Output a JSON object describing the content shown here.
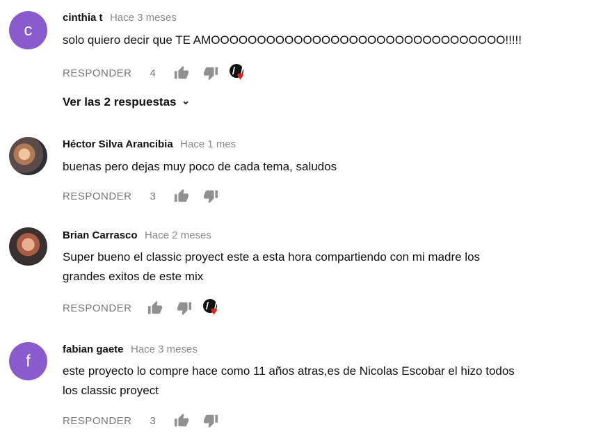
{
  "comments": [
    {
      "avatar_letter": "c",
      "author": "cinthia t",
      "time": "Hace 3 meses",
      "text_lines": [
        "solo quiero decir que TE AMOOOOOOOOOOOOOOOOOOOOOOOOOOOOOOOO!!!!!"
      ],
      "reply_label": "RESPONDER",
      "likes": "4",
      "creator_heart": true,
      "replies_label": "Ver las 2 respuestas"
    },
    {
      "avatar_letter": "",
      "author": "Héctor Silva Arancibia",
      "time": "Hace 1 mes",
      "text_lines": [
        "buenas pero dejas muy poco de cada tema, saludos"
      ],
      "reply_label": "RESPONDER",
      "likes": "3",
      "creator_heart": false
    },
    {
      "avatar_letter": "",
      "author": "Brian Carrasco",
      "time": "Hace 2 meses",
      "text_lines": [
        "Super bueno el classic proyect este a esta hora compartiendo con mi madre los",
        "grandes exitos de este mix"
      ],
      "reply_label": "RESPONDER",
      "likes": "",
      "creator_heart": true
    },
    {
      "avatar_letter": "f",
      "author": "fabian gaete",
      "time": "Hace 3 meses",
      "text_lines": [
        "este proyecto lo compre hace como 11 años atras,es de Nicolas Escobar el hizo todos",
        "los classic proyect"
      ],
      "reply_label": "RESPONDER",
      "likes": "3",
      "creator_heart": false
    }
  ],
  "colors": {
    "avatar_purple": "#8a5bcd",
    "heart_red": "#e62117",
    "icon_grey": "#909090"
  },
  "icons": {
    "like": "thumb-up-icon",
    "dislike": "thumb-down-icon",
    "expand": "chevron-down-icon",
    "heart": "creator-heart-icon"
  }
}
